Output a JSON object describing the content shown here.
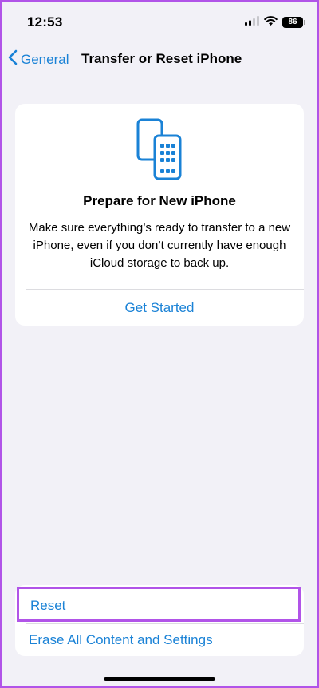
{
  "status_bar": {
    "time": "12:53",
    "battery_level": "86",
    "icons": [
      "signal-icon",
      "wifi-icon",
      "battery-icon"
    ]
  },
  "nav": {
    "back_label": "General",
    "title": "Transfer or Reset iPhone"
  },
  "prepare_card": {
    "icon": "phones-transfer-icon",
    "title": "Prepare for New iPhone",
    "description": "Make sure everything’s ready to transfer to a new iPhone, even if you don’t currently have enough iCloud storage to back up.",
    "action_label": "Get Started"
  },
  "actions": {
    "reset_label": "Reset",
    "erase_label": "Erase All Content and Settings"
  },
  "colors": {
    "accent": "#1a82d6",
    "background": "#f2f1f7",
    "highlight": "#b154e8"
  }
}
